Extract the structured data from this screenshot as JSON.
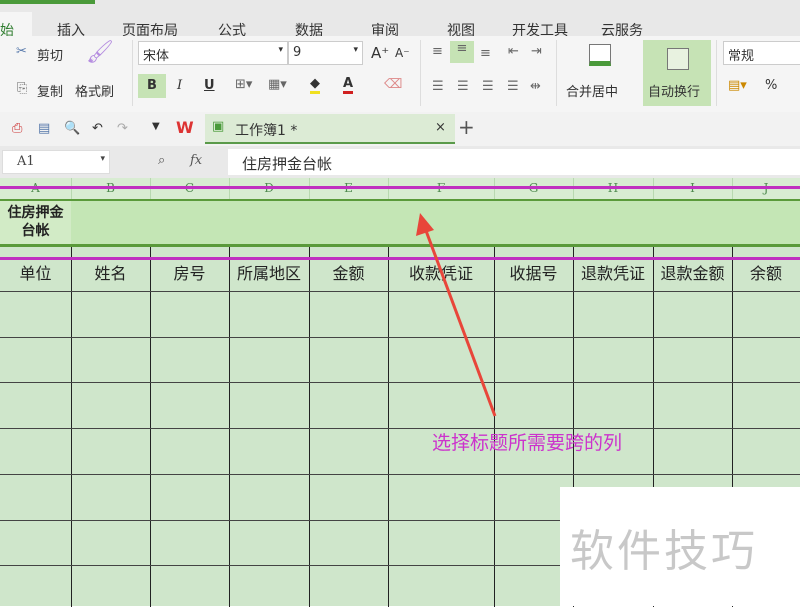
{
  "ribbon_tabs": [
    "始",
    "插入",
    "页面布局",
    "公式",
    "数据",
    "审阅",
    "视图",
    "开发工具",
    "云服务"
  ],
  "clipboard": {
    "cut": "剪切",
    "copy": "复制",
    "format_painter": "格式刷"
  },
  "font": {
    "name": "宋体",
    "size": "9",
    "bold": "B",
    "italic": "I",
    "underline": "U"
  },
  "align": {
    "merge_center": "合并居中",
    "wrap_text": "自动换行"
  },
  "number_format": {
    "value": "常规",
    "percent": "%"
  },
  "doc_tab": {
    "title": "工作簿1 *",
    "close": "×",
    "new": "+"
  },
  "formula_bar": {
    "cell_ref": "A1",
    "fx": "fx",
    "content": "住房押金台帐"
  },
  "columns": [
    "A",
    "B",
    "C",
    "D",
    "E",
    "F",
    "G",
    "H",
    "I",
    "J"
  ],
  "title_cell": "住房押金台帐",
  "headers": [
    "单位",
    "姓名",
    "房号",
    "所属地区",
    "金额",
    "收款凭证",
    "收据号",
    "退款凭证",
    "退款金额",
    "余额"
  ],
  "annotation": "选择标题所需要跨的列",
  "watermark": "软件技巧",
  "colors": {
    "accent": "#4a9a3a",
    "annotation": "#cc33cc",
    "arrow": "#e8463a",
    "grid_bg": "#cfe6cb"
  }
}
